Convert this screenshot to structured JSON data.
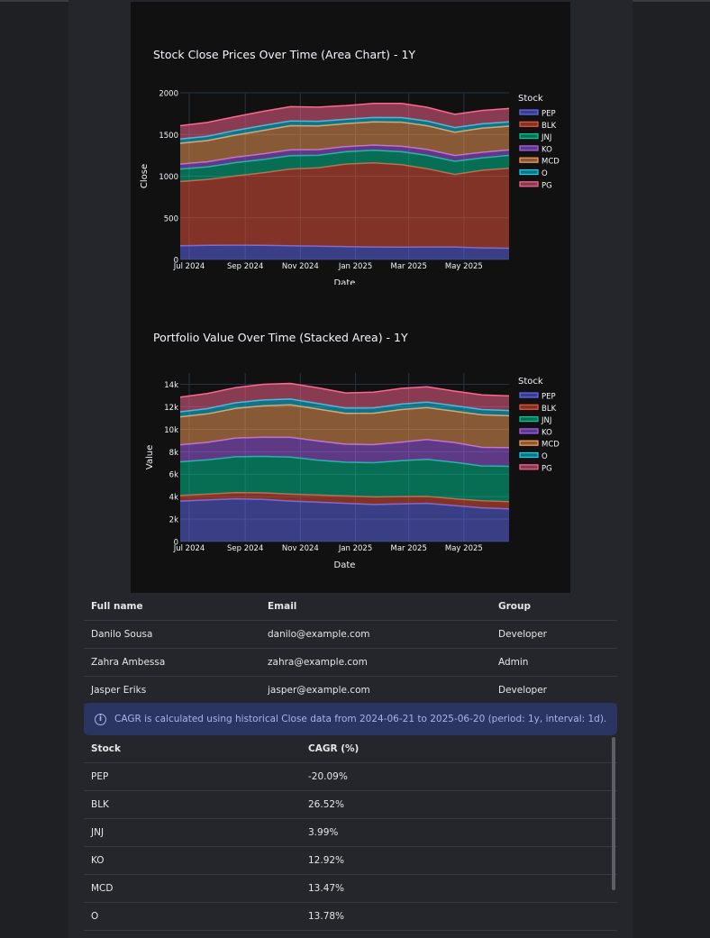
{
  "chart_data": [
    {
      "type": "area",
      "title": "Stock Close Prices Over Time (Area Chart) - 1Y",
      "xlabel": "Date",
      "ylabel": "Close",
      "ylim": [
        0,
        2000
      ],
      "yticks": [
        "0",
        "500",
        "1000",
        "1500",
        "2000"
      ],
      "xticks": [
        "Jul 2024",
        "Sep 2024",
        "Nov 2024",
        "Jan 2025",
        "Mar 2025",
        "May 2025"
      ],
      "x": [
        "2024-06-21",
        "2024-07-21",
        "2024-08-21",
        "2024-09-21",
        "2024-10-21",
        "2024-11-21",
        "2024-12-21",
        "2025-01-21",
        "2025-02-21",
        "2025-03-21",
        "2025-04-21",
        "2025-05-21",
        "2025-06-20"
      ],
      "legend_title": "Stock",
      "legend_position": "right",
      "stacked": true,
      "series": [
        {
          "name": "PEP",
          "color": "#636efa",
          "values": [
            165,
            170,
            172,
            170,
            165,
            160,
            155,
            150,
            148,
            150,
            150,
            140,
            135
          ]
        },
        {
          "name": "BLK",
          "color": "#ef553b",
          "values": [
            770,
            790,
            830,
            870,
            920,
            940,
            990,
            1010,
            990,
            940,
            870,
            930,
            960
          ]
        },
        {
          "name": "JNJ",
          "color": "#00cc96",
          "values": [
            150,
            150,
            160,
            160,
            160,
            150,
            148,
            150,
            155,
            160,
            158,
            150,
            155
          ]
        },
        {
          "name": "KO",
          "color": "#ab63fa",
          "values": [
            60,
            62,
            65,
            68,
            70,
            68,
            62,
            62,
            65,
            70,
            70,
            65,
            65
          ]
        },
        {
          "name": "MCD",
          "color": "#ffa15a",
          "values": [
            250,
            255,
            265,
            280,
            290,
            285,
            275,
            280,
            290,
            285,
            280,
            290,
            285
          ]
        },
        {
          "name": "O",
          "color": "#19d3f3",
          "values": [
            50,
            52,
            57,
            60,
            58,
            55,
            52,
            52,
            55,
            57,
            55,
            53,
            52
          ]
        },
        {
          "name": "PG",
          "color": "#ff6692",
          "values": [
            160,
            165,
            165,
            170,
            170,
            170,
            165,
            170,
            170,
            165,
            160,
            160,
            160
          ]
        }
      ]
    },
    {
      "type": "area",
      "title": "Portfolio Value Over Time (Stacked Area) - 1Y",
      "xlabel": "Date",
      "ylabel": "Value",
      "ylim": [
        0,
        15000
      ],
      "yticks": [
        "0",
        "2k",
        "4k",
        "6k",
        "8k",
        "10k",
        "12k",
        "14k"
      ],
      "xticks": [
        "Jul 2024",
        "Sep 2024",
        "Nov 2024",
        "Jan 2025",
        "Mar 2025",
        "May 2025"
      ],
      "x": [
        "2024-06-21",
        "2024-07-21",
        "2024-08-21",
        "2024-09-21",
        "2024-10-21",
        "2024-11-21",
        "2024-12-21",
        "2025-01-21",
        "2025-02-21",
        "2025-03-21",
        "2025-04-21",
        "2025-05-21",
        "2025-06-20"
      ],
      "legend_title": "Stock",
      "legend_position": "right",
      "stacked": true,
      "series": [
        {
          "name": "PEP",
          "color": "#636efa",
          "values": [
            3600,
            3700,
            3800,
            3750,
            3600,
            3500,
            3400,
            3300,
            3350,
            3400,
            3200,
            3000,
            2900
          ]
        },
        {
          "name": "BLK",
          "color": "#ef553b",
          "values": [
            500,
            520,
            550,
            580,
            620,
            640,
            660,
            670,
            650,
            620,
            600,
            630,
            650
          ]
        },
        {
          "name": "JNJ",
          "color": "#00cc96",
          "values": [
            3000,
            3050,
            3200,
            3250,
            3300,
            3100,
            3000,
            3050,
            3200,
            3300,
            3250,
            3100,
            3150
          ]
        },
        {
          "name": "KO",
          "color": "#ab63fa",
          "values": [
            1500,
            1550,
            1650,
            1700,
            1750,
            1700,
            1600,
            1600,
            1650,
            1750,
            1750,
            1650,
            1650
          ]
        },
        {
          "name": "MCD",
          "color": "#ffa15a",
          "values": [
            2500,
            2550,
            2650,
            2800,
            2900,
            2850,
            2750,
            2800,
            2900,
            2850,
            2800,
            2900,
            2850
          ]
        },
        {
          "name": "O",
          "color": "#19d3f3",
          "values": [
            450,
            460,
            500,
            520,
            510,
            490,
            470,
            470,
            490,
            500,
            490,
            470,
            460
          ]
        },
        {
          "name": "PG",
          "color": "#ff6692",
          "values": [
            1300,
            1350,
            1350,
            1400,
            1400,
            1400,
            1350,
            1400,
            1400,
            1350,
            1300,
            1300,
            1300
          ]
        }
      ]
    }
  ],
  "users_table": {
    "headers": [
      "Full name",
      "Email",
      "Group"
    ],
    "rows": [
      [
        "Danilo Sousa",
        "danilo@example.com",
        "Developer"
      ],
      [
        "Zahra Ambessa",
        "zahra@example.com",
        "Admin"
      ],
      [
        "Jasper Eriks",
        "jasper@example.com",
        "Developer"
      ]
    ]
  },
  "alert": {
    "icon": "info-icon",
    "text": "CAGR is calculated using historical Close data from 2024-06-21 to 2025-06-20 (period: 1y, interval: 1d)."
  },
  "cagr_table": {
    "headers": [
      "Stock",
      "CAGR (%)"
    ],
    "rows": [
      [
        "PEP",
        "-20.09%"
      ],
      [
        "BLK",
        "26.52%"
      ],
      [
        "JNJ",
        "3.99%"
      ],
      [
        "KO",
        "12.92%"
      ],
      [
        "MCD",
        "13.47%"
      ],
      [
        "O",
        "13.78%"
      ]
    ]
  }
}
